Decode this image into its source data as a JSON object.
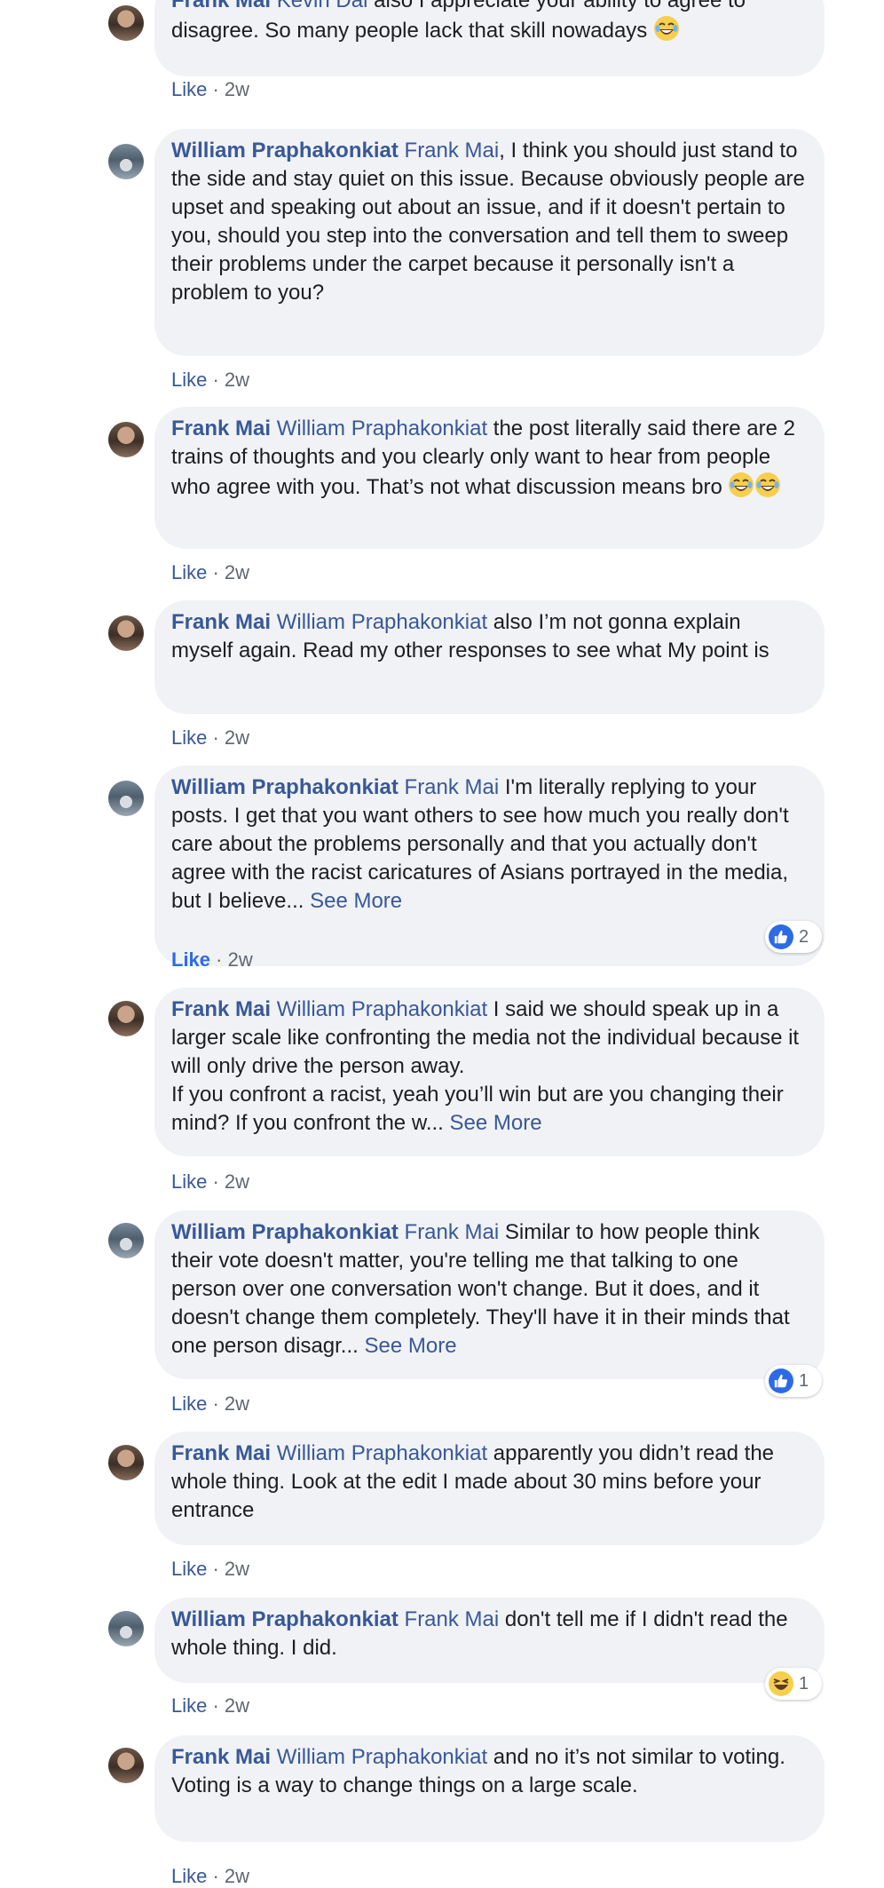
{
  "comments": [
    {
      "author": "Frank Mai",
      "avatar": "frank",
      "mention": "Kevin Dai",
      "text": " also I appreciate your ability to agree to disagree. So many people lack that skill nowadays ",
      "emoji": "laughing-tears-emoji",
      "emoji_count": 1,
      "like": "Like",
      "time": "2w"
    },
    {
      "author": "William Praphakonkiat",
      "avatar": "william",
      "mention": "Frank Mai",
      "text": ", I think you should just stand to the side and stay quiet on this issue. Because obviously people are upset and speaking out about an issue, and if it doesn't pertain to you, should you step into the conversation and tell them to sweep their problems under the carpet because it personally isn't a problem to you?",
      "like": "Like",
      "time": "2w"
    },
    {
      "author": "Frank Mai",
      "avatar": "frank",
      "mention": "William Praphakonkiat",
      "text": " the post literally said there are 2 trains of thoughts and you clearly only want to hear from people who agree with you. That’s not what discussion means bro ",
      "emoji": "laughing-tears-emoji",
      "emoji_count": 2,
      "like": "Like",
      "time": "2w"
    },
    {
      "author": "Frank Mai",
      "avatar": "frank",
      "mention": "William Praphakonkiat",
      "text": " also I’m not gonna explain myself again. Read my other responses to see what My point is",
      "like": "Like",
      "time": "2w"
    },
    {
      "author": "William Praphakonkiat",
      "avatar": "william",
      "mention": "Frank Mai",
      "text": " I'm literally replying to your posts. I get that you want others to see how much you really don't care about the problems personally and that you actually don't agree with the racist caricatures of Asians portrayed in the media, but I believe... ",
      "see_more": "See More",
      "like": "Like",
      "like_active": true,
      "time": "2w",
      "reaction": {
        "icon": "thumbs-up-icon",
        "count": "2"
      }
    },
    {
      "author": "Frank Mai",
      "avatar": "frank",
      "mention": "William Praphakonkiat",
      "text": " I said we should speak up in a larger scale like confronting the media not the individual because it will only drive the person away.\nIf you confront a racist, yeah you’ll win but are you changing their mind? If you confront the w... ",
      "see_more": "See More",
      "like": "Like",
      "time": "2w"
    },
    {
      "author": "William Praphakonkiat",
      "avatar": "william",
      "mention": "Frank Mai",
      "text": " Similar to how people think their vote doesn't matter, you're telling me that talking to one person over one conversation won't change. But it does, and it doesn't change them completely. They'll have it in their minds that one person disagr... ",
      "see_more": "See More",
      "like": "Like",
      "time": "2w",
      "reaction": {
        "icon": "thumbs-up-icon",
        "count": "1"
      }
    },
    {
      "author": "Frank Mai",
      "avatar": "frank",
      "mention": "William Praphakonkiat",
      "text": " apparently you didn’t read the whole thing. Look at the edit I made about 30 mins before your entrance",
      "like": "Like",
      "time": "2w"
    },
    {
      "author": "William Praphakonkiat",
      "avatar": "william",
      "mention": "Frank Mai",
      "text": " don't tell me if I didn't read the whole thing. I did.",
      "like": "Like",
      "time": "2w",
      "reaction": {
        "icon": "haha-icon",
        "count": "1"
      }
    },
    {
      "author": "Frank Mai",
      "avatar": "frank",
      "mention": "William Praphakonkiat",
      "text": " and no it’s not similar to voting. Voting is a way to change things on a large scale.",
      "like": "Like",
      "time": "2w"
    }
  ]
}
